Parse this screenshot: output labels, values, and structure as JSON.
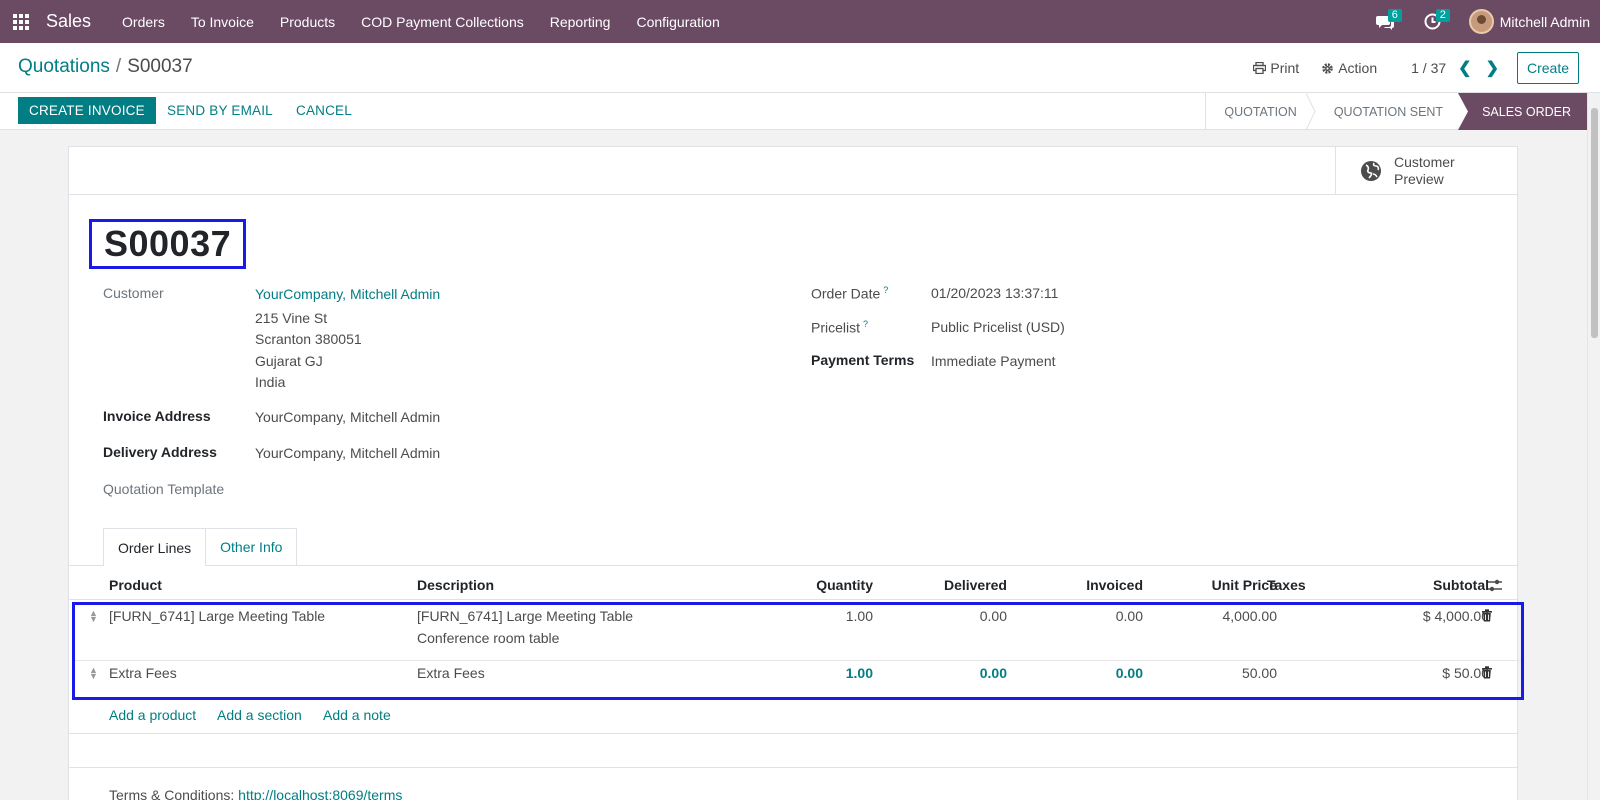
{
  "navbar": {
    "app_name": "Sales",
    "menu": [
      "Orders",
      "To Invoice",
      "Products",
      "COD Payment Collections",
      "Reporting",
      "Configuration"
    ],
    "messages_count": "6",
    "activities_count": "2",
    "user_name": "Mitchell Admin"
  },
  "control": {
    "breadcrumb_parent": "Quotations",
    "breadcrumb_separator": "/",
    "breadcrumb_current": "S00037",
    "print_label": "Print",
    "action_label": "Action",
    "pager": "1 / 37",
    "create_label": "Create"
  },
  "statusbar": {
    "create_invoice": "CREATE INVOICE",
    "send_by_email": "SEND BY EMAIL",
    "cancel": "CANCEL",
    "stages": [
      "QUOTATION",
      "QUOTATION SENT",
      "SALES ORDER"
    ],
    "active_stage": "SALES ORDER"
  },
  "sheet": {
    "customer_preview_line1": "Customer",
    "customer_preview_line2": "Preview",
    "order_name": "S00037",
    "customer_label": "Customer",
    "customer_name": "YourCompany, Mitchell Admin",
    "address": [
      "215 Vine St",
      "Scranton 380051",
      "Gujarat GJ",
      "India"
    ],
    "invoice_address_label": "Invoice Address",
    "invoice_address": "YourCompany, Mitchell Admin",
    "delivery_address_label": "Delivery Address",
    "delivery_address": "YourCompany, Mitchell Admin",
    "quotation_template_label": "Quotation Template",
    "order_date_label": "Order Date",
    "order_date": "01/20/2023 13:37:11",
    "pricelist_label": "Pricelist",
    "pricelist": "Public Pricelist (USD)",
    "payment_terms_label": "Payment Terms",
    "payment_terms": "Immediate Payment",
    "help_mark": "?"
  },
  "tabs": [
    "Order Lines",
    "Other Info"
  ],
  "table": {
    "headers": [
      "Product",
      "Description",
      "Quantity",
      "Delivered",
      "Invoiced",
      "Unit Price",
      "Taxes",
      "Subtotal"
    ],
    "rows": [
      {
        "product": "[FURN_6741] Large Meeting Table",
        "description_line1": "[FURN_6741] Large Meeting Table",
        "description_line2": "Conference room table",
        "quantity": "1.00",
        "delivered": "0.00",
        "invoiced": "0.00",
        "unit_price": "4,000.00",
        "subtotal": "$ 4,000.00"
      },
      {
        "product": "Extra Fees",
        "description_line1": "Extra Fees",
        "description_line2": "",
        "quantity": "1.00",
        "delivered": "0.00",
        "invoiced": "0.00",
        "unit_price": "50.00",
        "subtotal": "$ 50.00"
      }
    ],
    "add_product": "Add a product",
    "add_section": "Add a section",
    "add_note": "Add a note"
  },
  "terms": {
    "label": "Terms & Conditions:",
    "link": "http://localhost:8069/terms"
  }
}
